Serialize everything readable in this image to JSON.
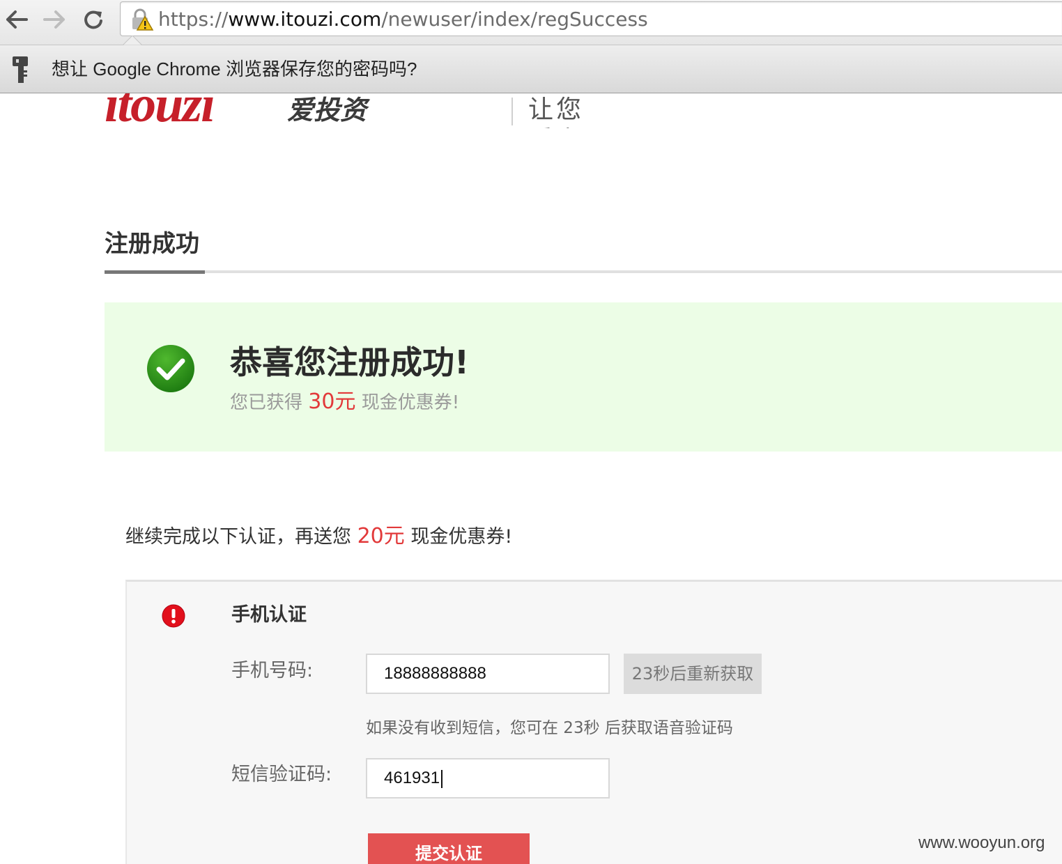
{
  "browser": {
    "url_prefix": "https://",
    "url_host": "www.itouzi.com",
    "url_path": "/newuser/index/regSuccess",
    "infobar_text": "想让 Google Chrome 浏览器保存您的密码吗?"
  },
  "header": {
    "logo_text": "itouzi",
    "logo_cn": "爱投资",
    "slogan": "让您爱上投资"
  },
  "page_title": "注册成功",
  "success": {
    "title": "恭喜您注册成功!",
    "sub_prefix": "您已获得",
    "sub_amount": "30元",
    "sub_suffix": "现金优惠券!"
  },
  "promo": {
    "prefix": "继续完成以下认证，再送您",
    "amount": "20元",
    "suffix": "现金优惠券!"
  },
  "verify": {
    "section_title": "手机认证",
    "phone_label": "手机号码:",
    "phone_value": "18888888888",
    "resend_label": "23秒后重新获取",
    "hint": "如果没有收到短信，您可在 23秒 后获取语音验证码",
    "code_label": "短信验证码:",
    "code_value": "461931",
    "submit_label": "提交认证"
  },
  "watermark": "www.wooyun.org",
  "colors": {
    "accent_red": "#e2393a",
    "success_bg": "#ecfde6",
    "check_green": "#2f8f1a",
    "submit_bg": "#e35252"
  }
}
